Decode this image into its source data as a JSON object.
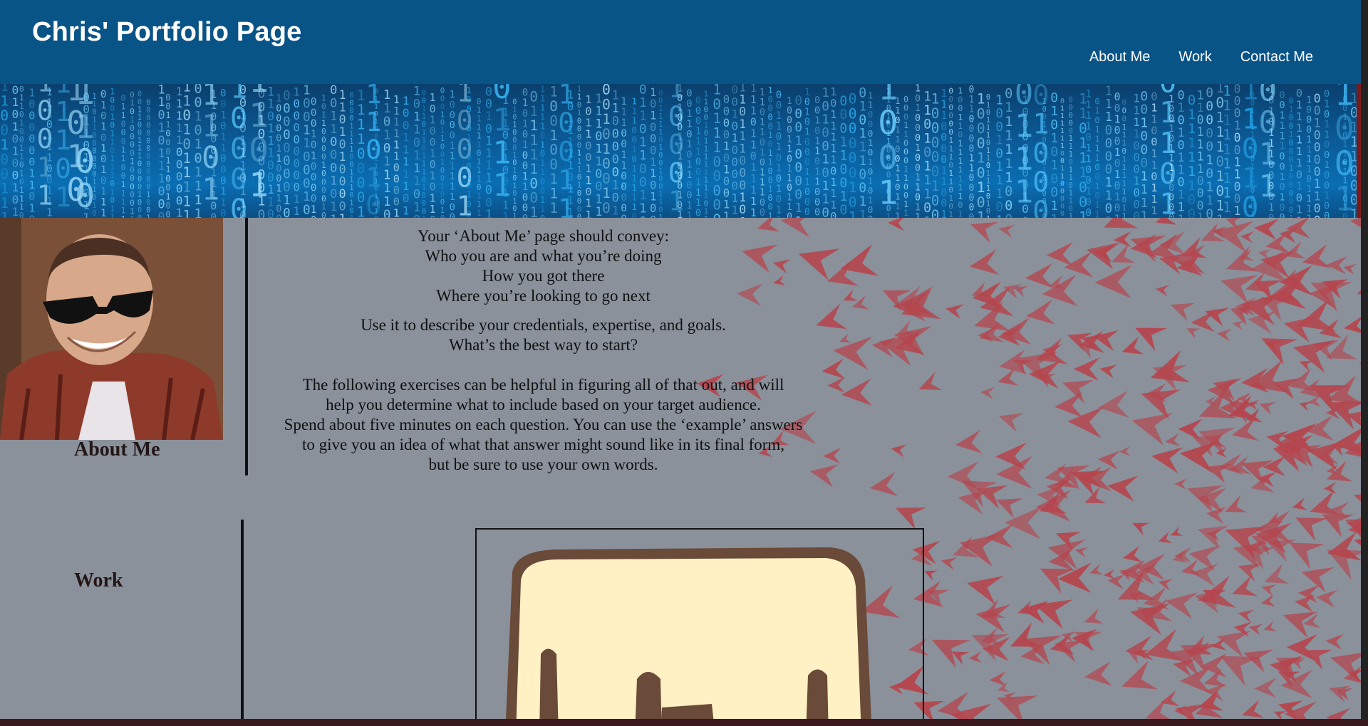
{
  "header": {
    "title": "Chris' Portfolio Page",
    "nav": [
      {
        "label": "About Me"
      },
      {
        "label": "Work"
      },
      {
        "label": "Contact Me"
      }
    ]
  },
  "about": {
    "heading": "About Me",
    "lines": [
      "Your ‘About Me’ page should convey:",
      "Who you are and what you’re doing",
      "How you got there",
      "Where you’re looking to go next",
      "Use it to describe your credentials, expertise, and goals.",
      "What’s the best way to start?",
      "The following exercises can be helpful in figuring all of that out, and will",
      "help you determine what to include based on your target audience.",
      "Spend about five minutes on each question. You can use the ‘example’ answers",
      "to give you an idea of what that answer might sound like in its final form,",
      "but be sure to use your own words."
    ]
  },
  "work": {
    "heading": "Work"
  },
  "colors": {
    "header_bg": "#095487",
    "page_bg": "#8a919b",
    "flock": "#b5454d",
    "heading_text": "#231616"
  }
}
